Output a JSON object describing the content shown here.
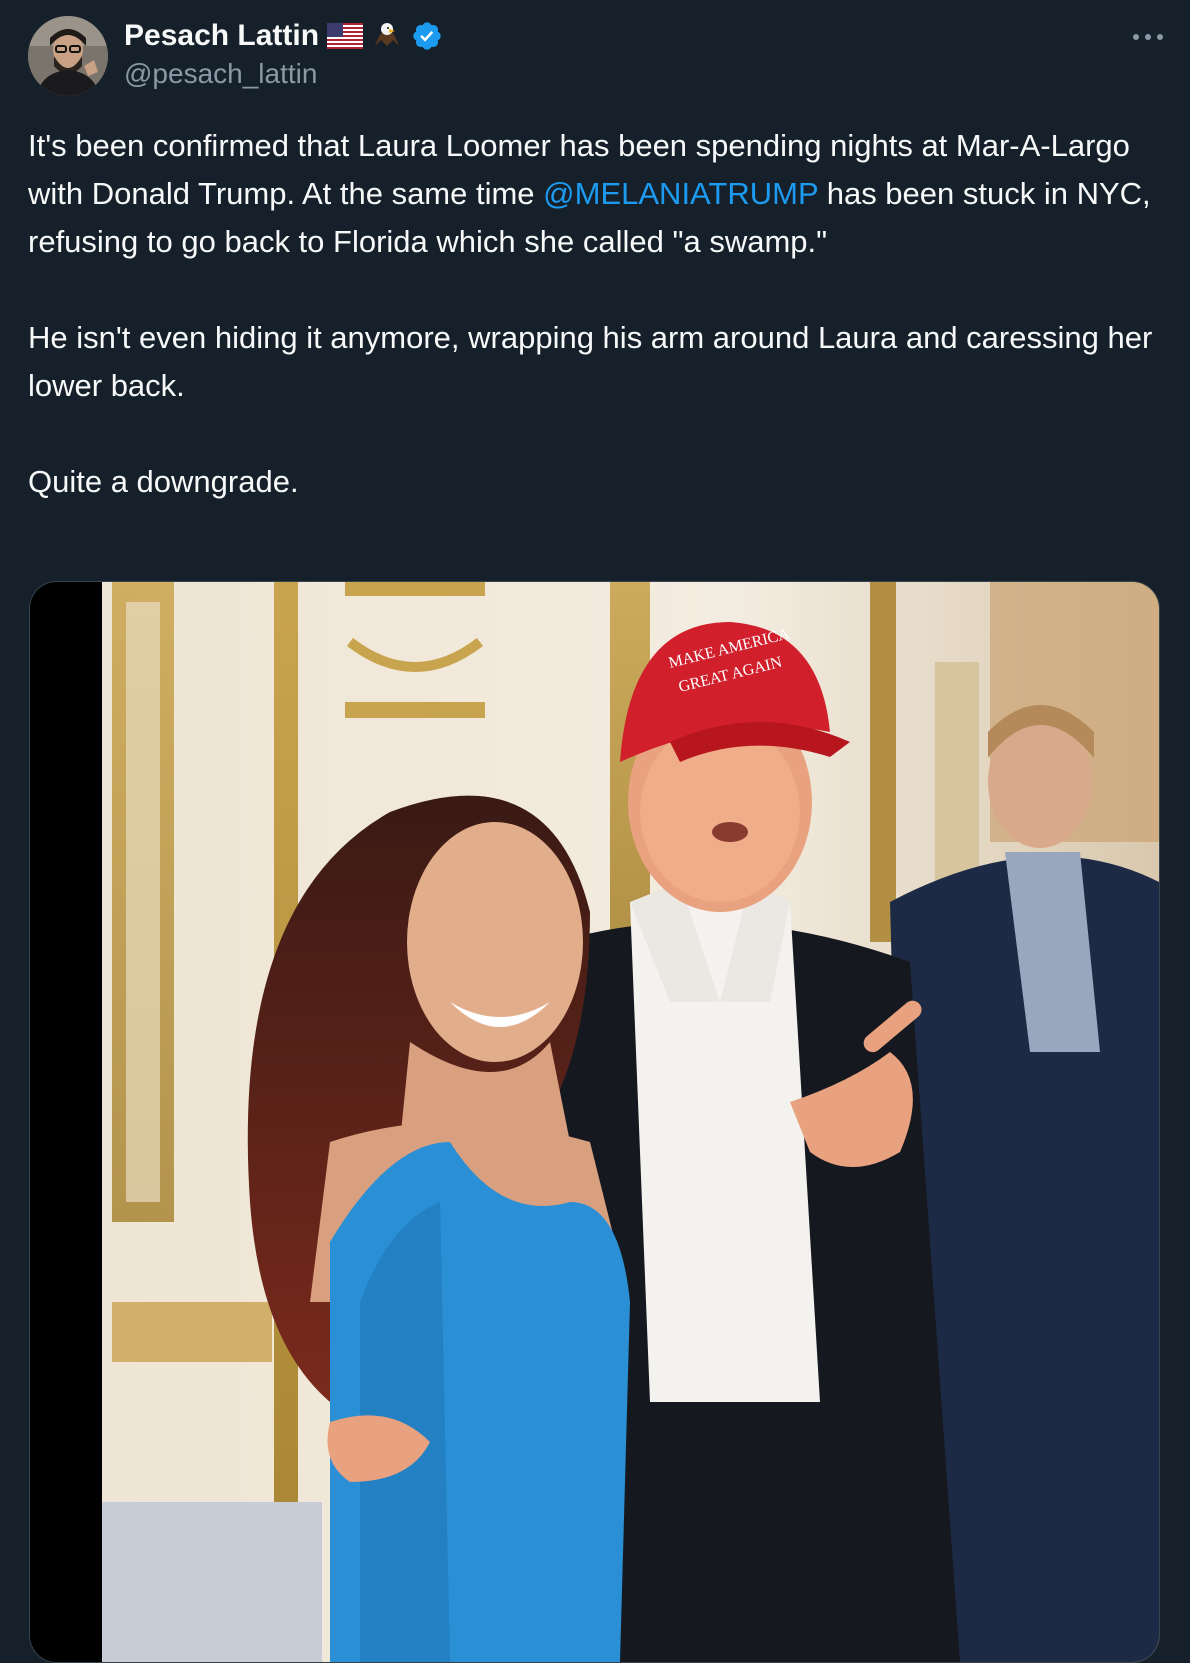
{
  "author": {
    "display_name": "Pesach Lattin",
    "handle": "@pesach_lattin",
    "name_emojis": [
      "us-flag-emoji",
      "eagle-emoji"
    ],
    "verified": true
  },
  "tweet": {
    "paragraph1_before": "It's been confirmed that Laura Loomer has been spending nights at Mar-A-Largo with Donald Trump. At the same time ",
    "mention": "@MELANIATRUMP",
    "paragraph1_after": " has been stuck in NYC, refusing to go back to Florida which she called \"a swamp.\"",
    "paragraph2": "He isn't even hiding it anymore, wrapping his arm around Laura and caressing her lower back.",
    "paragraph3": "Quite a downgrade."
  },
  "media": {
    "hat_text": "MAKE AMERICA GREAT AGAIN"
  },
  "icons": {
    "more": "more-options-icon",
    "verified": "verified-badge-icon"
  },
  "colors": {
    "background": "#15202b",
    "text": "#f7f9f9",
    "secondary_text": "#8b98a5",
    "link": "#1d9bf0",
    "verified_badge": "#1d9bf0",
    "border": "#38444d"
  }
}
